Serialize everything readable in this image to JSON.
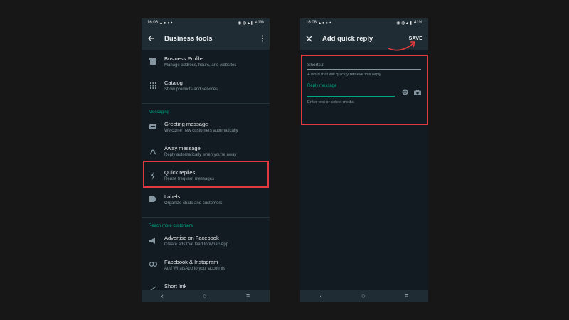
{
  "phone1": {
    "status": {
      "time": "16:06",
      "battery": "41%"
    },
    "appbar": {
      "title": "Business tools"
    },
    "items_top": [
      {
        "title": "Business Profile",
        "subtitle": "Manage address, hours, and websites",
        "icon": "store-icon"
      },
      {
        "title": "Catalog",
        "subtitle": "Show products and services",
        "icon": "grid-icon"
      }
    ],
    "section_messaging": "Messaging",
    "items_messaging": [
      {
        "title": "Greeting message",
        "subtitle": "Welcome new customers automatically",
        "icon": "greeting-icon"
      },
      {
        "title": "Away message",
        "subtitle": "Reply automatically when you're away",
        "icon": "away-icon"
      },
      {
        "title": "Quick replies",
        "subtitle": "Reuse frequent messages",
        "icon": "lightning-icon"
      },
      {
        "title": "Labels",
        "subtitle": "Organize chats and customers",
        "icon": "label-icon"
      }
    ],
    "section_reach": "Reach more customers",
    "items_reach": [
      {
        "title": "Advertise on Facebook",
        "subtitle": "Create ads that lead to WhatsApp",
        "icon": "megaphone-icon"
      },
      {
        "title": "Facebook & Instagram",
        "subtitle": "Add WhatsApp to your accounts",
        "icon": "link-icon"
      },
      {
        "title": "Short link",
        "subtitle": "",
        "icon": "short-link-icon"
      }
    ]
  },
  "phone2": {
    "status": {
      "time": "16:08",
      "battery": "41%"
    },
    "appbar": {
      "title": "Add quick reply",
      "save": "SAVE"
    },
    "shortcut": {
      "placeholder": "Shortcut",
      "hint": "A word that will quickly retrieve this reply"
    },
    "reply": {
      "label": "Reply message",
      "hint": "Enter text or select media"
    }
  },
  "colors": {
    "accent": "#00a884",
    "highlight": "#e0393e",
    "background": "#111b21",
    "appbar": "#1f2c34"
  }
}
